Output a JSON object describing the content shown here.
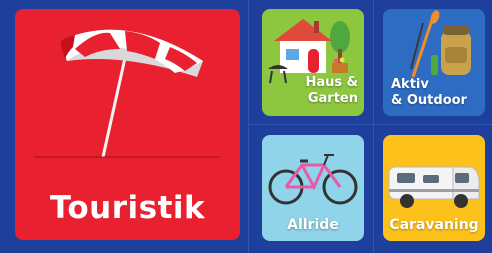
{
  "tiles": {
    "touristik": {
      "label": "Touristik",
      "color": "#e8202f",
      "icon": "beach-umbrella-icon"
    },
    "haus_garten": {
      "label_line1": "Haus &",
      "label_line2": "Garten",
      "color": "#8dc63f",
      "icon": "house-icon"
    },
    "aktiv_outdoor": {
      "label_line1": "Aktiv",
      "label_line2": "& Outdoor",
      "color": "#2e6cc4",
      "icon": "backpack-paddle-icon"
    },
    "allride": {
      "label": "Allride",
      "color": "#8fd4e8",
      "icon": "bicycle-icon"
    },
    "caravaning": {
      "label": "Caravaning",
      "color": "#fcc21b",
      "icon": "camper-van-icon"
    }
  }
}
